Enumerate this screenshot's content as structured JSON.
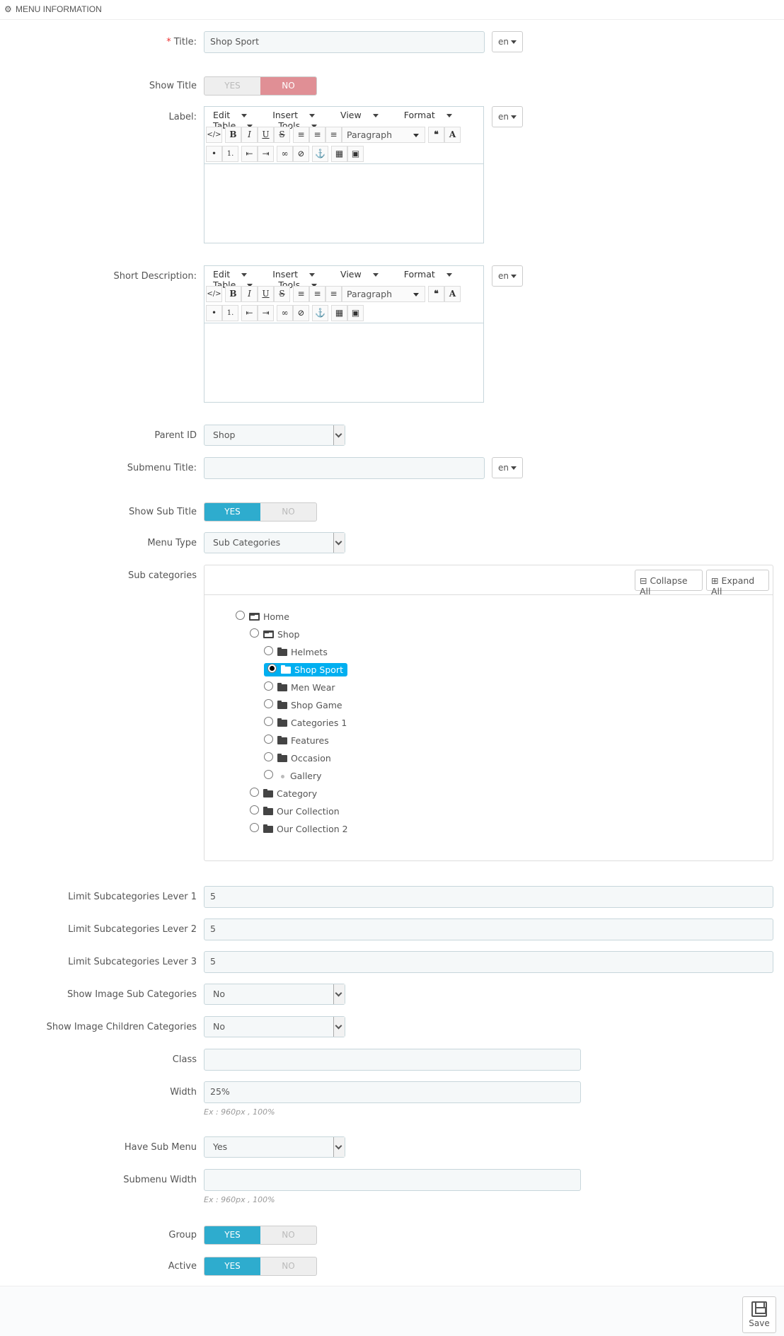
{
  "header": {
    "icon": "cogs-icon",
    "title": "MENU INFORMATION"
  },
  "title_field": {
    "label": "Title:",
    "required_mark": "*",
    "value": "Shop Sport",
    "lang": "en"
  },
  "show_title": {
    "label": "Show Title",
    "yes": "YES",
    "no": "NO",
    "value": "NO"
  },
  "label_field": {
    "label": "Label:",
    "lang": "en"
  },
  "short_description": {
    "label": "Short Description:",
    "lang": "en"
  },
  "editor": {
    "menu": [
      "Edit",
      "Insert",
      "View",
      "Format",
      "Table",
      "Tools"
    ],
    "block_format": "Paragraph"
  },
  "parent_id": {
    "label": "Parent ID",
    "value": "Shop"
  },
  "submenu_title": {
    "label": "Submenu Title:",
    "value": "",
    "lang": "en"
  },
  "show_sub_title": {
    "label": "Show Sub Title",
    "yes": "YES",
    "no": "NO",
    "value": "YES"
  },
  "menu_type": {
    "label": "Menu Type",
    "value": "Sub Categories"
  },
  "sub_categories": {
    "label": "Sub categories",
    "collapse_all": "Collapse All",
    "expand_all": "Expand All",
    "nodes": [
      {
        "label": "Home",
        "selected": false
      },
      {
        "label": "Shop",
        "selected": false
      },
      {
        "label": "Helmets",
        "selected": false
      },
      {
        "label": "Shop Sport",
        "selected": true
      },
      {
        "label": "Men Wear",
        "selected": false
      },
      {
        "label": "Shop Game",
        "selected": false
      },
      {
        "label": "Categories 1",
        "selected": false
      },
      {
        "label": "Features",
        "selected": false
      },
      {
        "label": "Occasion",
        "selected": false
      },
      {
        "label": "Gallery",
        "selected": false
      },
      {
        "label": "Category",
        "selected": false
      },
      {
        "label": "Our Collection",
        "selected": false
      },
      {
        "label": "Our Collection 2",
        "selected": false
      }
    ]
  },
  "limit1": {
    "label": "Limit Subcategories Lever 1",
    "value": "5"
  },
  "limit2": {
    "label": "Limit Subcategories Lever 2",
    "value": "5"
  },
  "limit3": {
    "label": "Limit Subcategories Lever 3",
    "value": "5"
  },
  "show_image_sub": {
    "label": "Show Image Sub Categories",
    "value": "No"
  },
  "show_image_children": {
    "label": "Show Image Children Categories",
    "value": "No"
  },
  "class_field": {
    "label": "Class",
    "value": ""
  },
  "width_field": {
    "label": "Width",
    "value": "25%",
    "hint": "Ex : 960px , 100%"
  },
  "have_sub_menu": {
    "label": "Have Sub Menu",
    "value": "Yes"
  },
  "submenu_width": {
    "label": "Submenu Width",
    "value": "",
    "hint": "Ex : 960px , 100%"
  },
  "group": {
    "label": "Group",
    "yes": "YES",
    "no": "NO",
    "value": "YES"
  },
  "active": {
    "label": "Active",
    "yes": "YES",
    "no": "NO",
    "value": "YES"
  },
  "footer": {
    "save_label": "Save"
  }
}
